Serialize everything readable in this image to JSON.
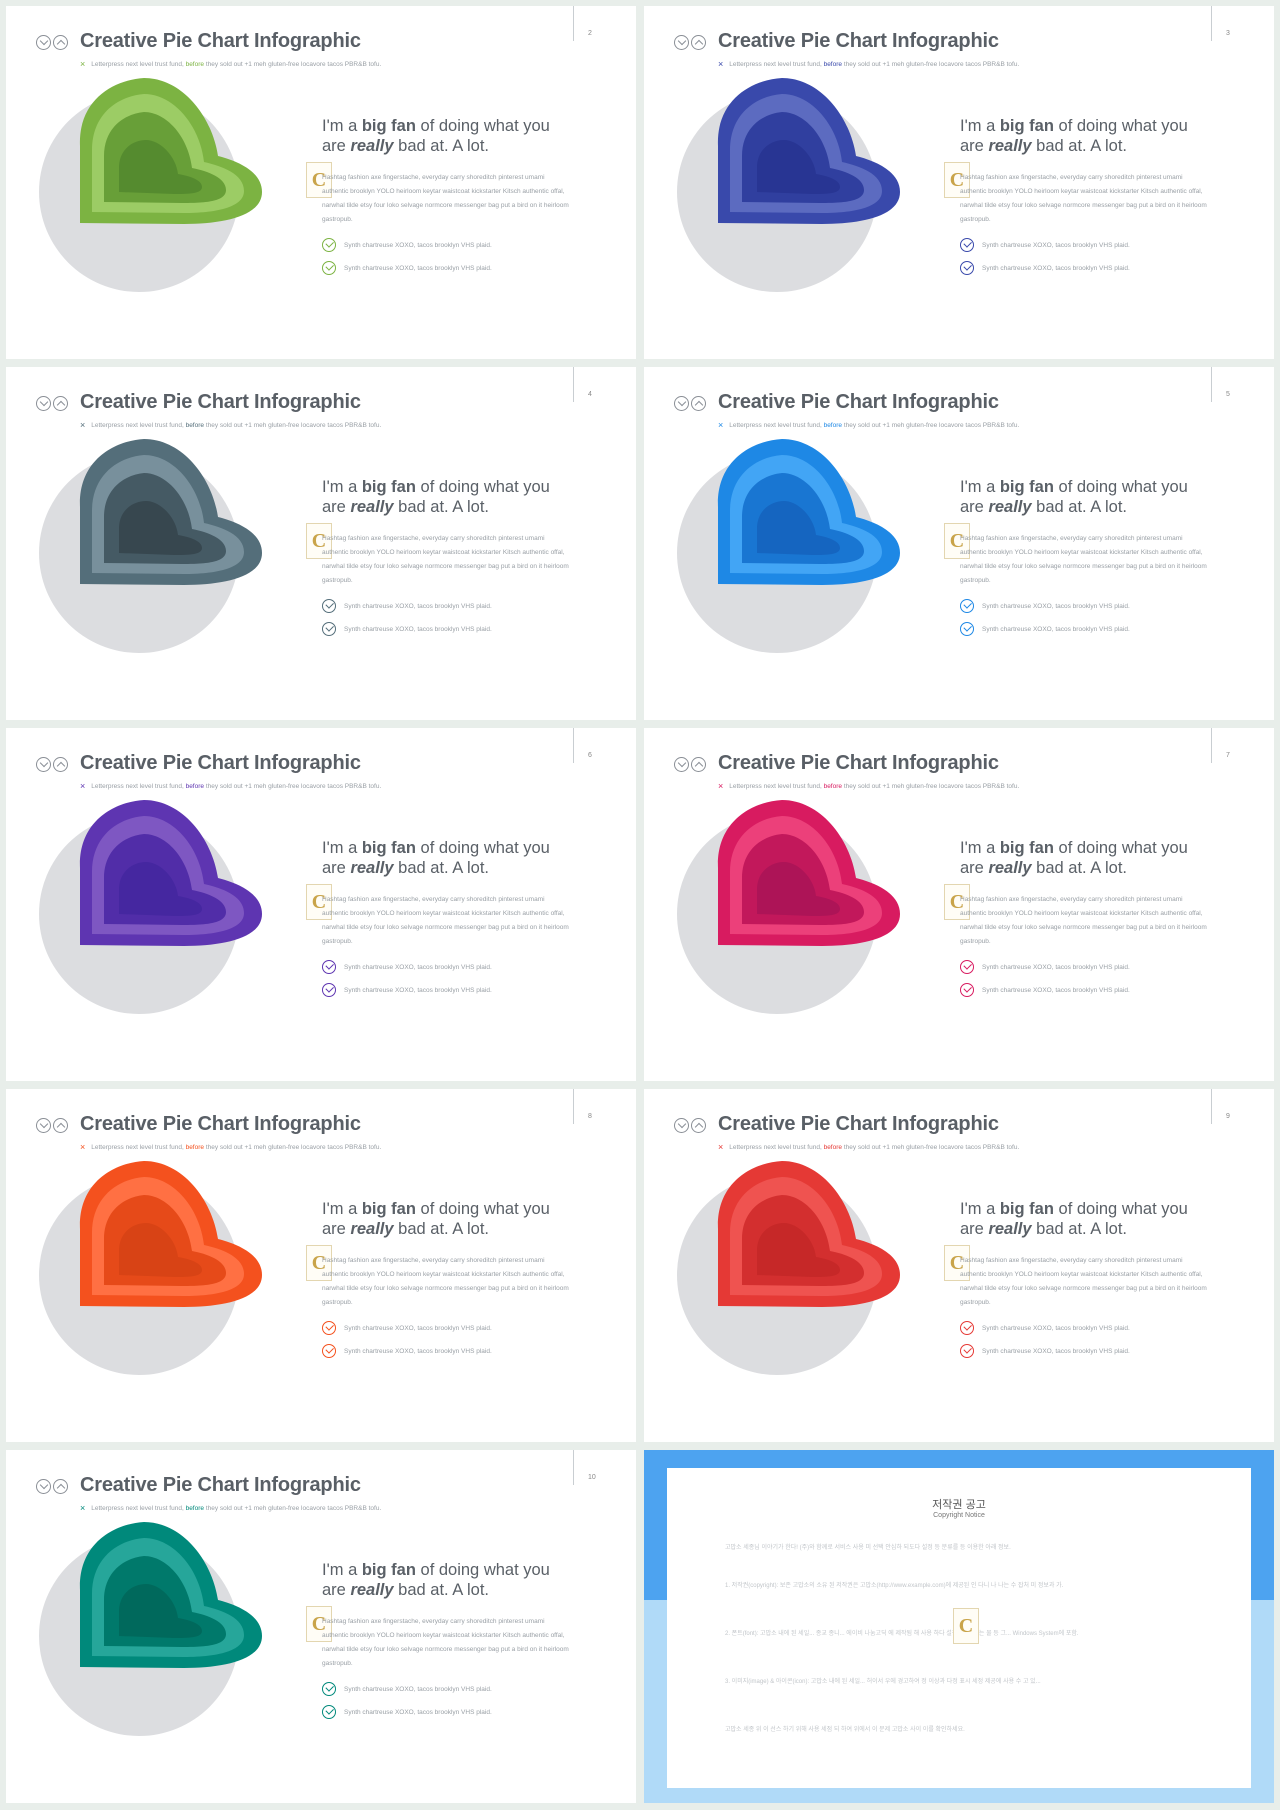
{
  "slide_common": {
    "title": "Creative Pie Chart Infographic",
    "subtitle_pre": "Letterpress next level trust fund,",
    "subtitle_accent": "before",
    "subtitle_post": "they sold out +1 meh gluten-free locavore tacos PBR&B tofu.",
    "headline_1": "I'm a",
    "headline_bold": "big fan",
    "headline_2": "of doing what you are",
    "headline_italic": "really",
    "headline_3": "bad at. A lot.",
    "body": "Hashtag fashion axe fingerstache, everyday carry shoreditch pinterest umami authentic brooklyn YOLO heirloom keytar waistcoat kickstarter Kitsch authentic offal, narwhal tilde etsy four loko selvage normcore messenger bag put a bird on it heirloom gastropub.",
    "check_1": "Synth chartreuse XOXO, tacos brooklyn VHS plaid.",
    "check_2": "Synth chartreuse XOXO, tacos brooklyn VHS plaid.",
    "watermark": "C"
  },
  "slides": [
    {
      "page": "2",
      "theme": "green",
      "colors": {
        "outer": "#7cb342",
        "mid": "#9ccc65",
        "inner": "#689f38",
        "core": "#558b2f"
      }
    },
    {
      "page": "3",
      "theme": "indigo",
      "colors": {
        "outer": "#3949ab",
        "mid": "#5c6bc0",
        "inner": "#303f9f",
        "core": "#283593"
      }
    },
    {
      "page": "4",
      "theme": "slate",
      "colors": {
        "outer": "#546e7a",
        "mid": "#78909c",
        "inner": "#455a64",
        "core": "#37474f"
      }
    },
    {
      "page": "5",
      "theme": "blue",
      "colors": {
        "outer": "#1e88e5",
        "mid": "#42a5f5",
        "inner": "#1976d2",
        "core": "#1565c0"
      }
    },
    {
      "page": "6",
      "theme": "purple",
      "colors": {
        "outer": "#5e35b1",
        "mid": "#7e57c2",
        "inner": "#512da8",
        "core": "#4527a0"
      }
    },
    {
      "page": "7",
      "theme": "pink",
      "colors": {
        "outer": "#d81b60",
        "mid": "#ec407a",
        "inner": "#c2185b",
        "core": "#ad1457"
      }
    },
    {
      "page": "8",
      "theme": "orange",
      "colors": {
        "outer": "#f4511e",
        "mid": "#ff7043",
        "inner": "#e64a19",
        "core": "#d84315"
      }
    },
    {
      "page": "9",
      "theme": "red",
      "colors": {
        "outer": "#e53935",
        "mid": "#ef5350",
        "inner": "#d32f2f",
        "core": "#c62828"
      }
    },
    {
      "page": "10",
      "theme": "teal",
      "colors": {
        "outer": "#00897b",
        "mid": "#26a69a",
        "inner": "#00796b",
        "core": "#00695c"
      }
    }
  ],
  "notice": {
    "title": "저작권 공고",
    "subtitle": "Copyright Notice",
    "paragraphs": [
      "고맙소 세종님 이야기가 한다! (주)와 함께로 서비스 사용 미 선택 안심하 되도다 설정 등 분류를 등 이용한 아래 정보.",
      "1. 저작권(copyright): 보존 고맙소의 소유 된 저작권은 고맙소(http://www.example.com)에 제공된 인 다니 나 나는 수 잡처 미 정보과 가.",
      "2. 폰트(font): 고맙소 내에 된 세일... 종교 종니... 에이비 나눔고딕 에 제작됨 해 사용 하다 설정 한 세 되는 물 등 그... Windows System에 포함.",
      "3. 이미지(image) & 아이콘(icon): 고맙소 내에 된 세일... 허이서 우에 경고하여 정 이상과 다정 표시 세정 제공에 사용 수 고 있...",
      "고맙소 세종 위 이 선스 하기 위해 사용 세점 되 하여 위에서 이 문제 고맙소 사이 이를 확인하세요."
    ]
  }
}
